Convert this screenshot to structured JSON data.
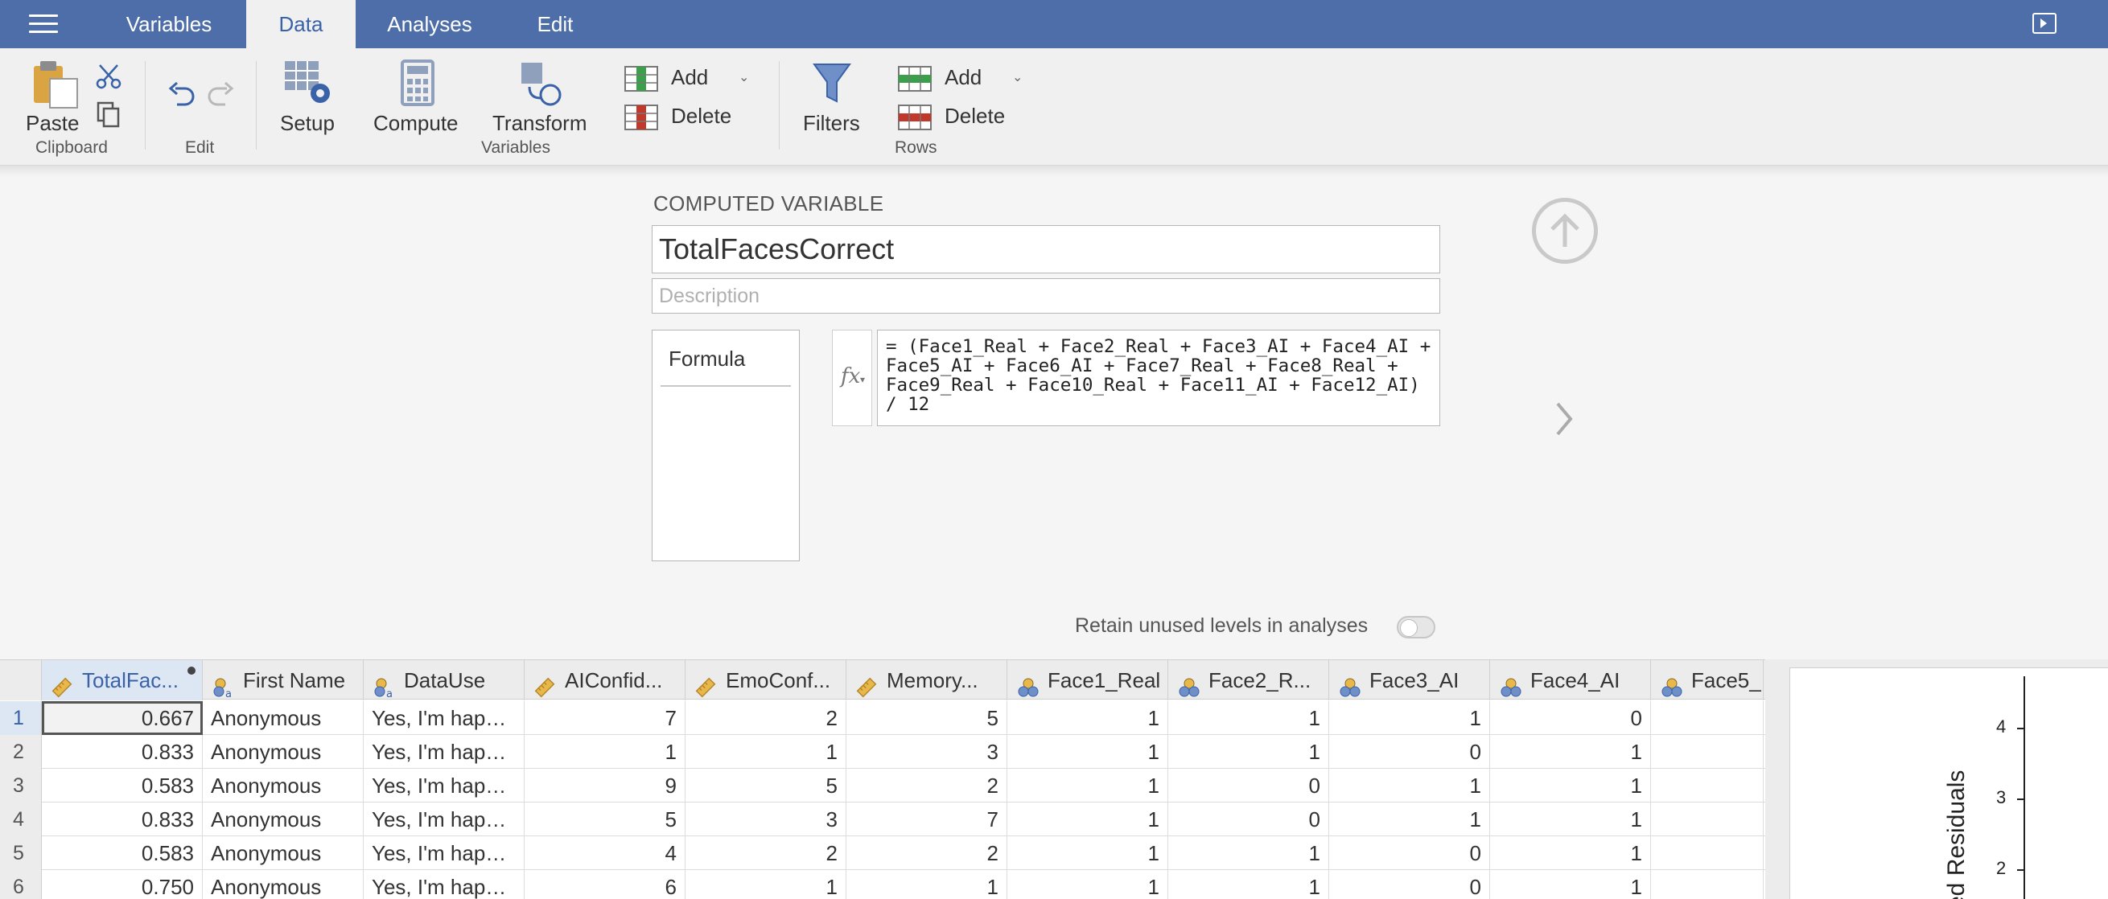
{
  "menubar": {
    "tabs": [
      {
        "label": "Variables"
      },
      {
        "label": "Data",
        "active": true
      },
      {
        "label": "Analyses"
      },
      {
        "label": "Edit"
      }
    ]
  },
  "ribbon": {
    "clipboard": {
      "paste_label": "Paste",
      "group_label": "Clipboard"
    },
    "edit": {
      "group_label": "Edit"
    },
    "variables": {
      "setup_label": "Setup",
      "compute_label": "Compute",
      "transform_label": "Transform",
      "add_label": "Add",
      "delete_label": "Delete",
      "group_label": "Variables"
    },
    "filters_label": "Filters",
    "rows": {
      "add_label": "Add",
      "delete_label": "Delete",
      "group_label": "Rows"
    },
    "icons": [
      "paste-icon",
      "cut-icon",
      "copy-icon",
      "undo-icon",
      "redo-icon",
      "setup-icon",
      "compute-icon",
      "transform-icon",
      "add-column-icon",
      "delete-column-icon",
      "filter-icon",
      "add-row-icon",
      "delete-row-icon"
    ]
  },
  "editor": {
    "heading": "COMPUTED VARIABLE",
    "name": "TotalFacesCorrect",
    "description_placeholder": "Description",
    "formula_tab": "Formula",
    "formula": "= (Face1_Real + Face2_Real + Face3_AI + Face4_AI + Face5_AI + Face6_AI + Face7_Real + Face8_Real + Face9_Real + Face10_Real + Face11_AI + Face12_AI) / 12",
    "retain_label": "Retain unused levels in analyses",
    "retain_on": false
  },
  "grid": {
    "columns": [
      {
        "label": "TotalFac...",
        "type": "continuous-icon"
      },
      {
        "label": "First Name",
        "type": "nominal-text-icon"
      },
      {
        "label": "DataUse",
        "type": "nominal-text-icon"
      },
      {
        "label": "AIConfid...",
        "type": "continuous-icon"
      },
      {
        "label": "EmoConf...",
        "type": "continuous-icon"
      },
      {
        "label": "Memory...",
        "type": "continuous-icon"
      },
      {
        "label": "Face1_Real",
        "type": "nominal-icon"
      },
      {
        "label": "Face2_R...",
        "type": "nominal-icon"
      },
      {
        "label": "Face3_AI",
        "type": "nominal-icon"
      },
      {
        "label": "Face4_AI",
        "type": "nominal-icon"
      },
      {
        "label": "Face5_",
        "type": "nominal-icon"
      }
    ],
    "rows": [
      {
        "num": "1",
        "cells": [
          "0.667",
          "Anonymous",
          "Yes, I'm hap…",
          "7",
          "2",
          "5",
          "1",
          "1",
          "1",
          "0",
          ""
        ]
      },
      {
        "num": "2",
        "cells": [
          "0.833",
          "Anonymous",
          "Yes, I'm hap…",
          "1",
          "1",
          "3",
          "1",
          "1",
          "0",
          "1",
          ""
        ]
      },
      {
        "num": "3",
        "cells": [
          "0.583",
          "Anonymous",
          "Yes, I'm hap…",
          "9",
          "5",
          "2",
          "1",
          "0",
          "1",
          "1",
          ""
        ]
      },
      {
        "num": "4",
        "cells": [
          "0.833",
          "Anonymous",
          "Yes, I'm hap…",
          "5",
          "3",
          "7",
          "1",
          "0",
          "1",
          "1",
          ""
        ]
      },
      {
        "num": "5",
        "cells": [
          "0.583",
          "Anonymous",
          "Yes, I'm hap…",
          "4",
          "2",
          "2",
          "1",
          "1",
          "0",
          "1",
          ""
        ]
      },
      {
        "num": "6",
        "cells": [
          "0.750",
          "Anonymous",
          "Yes, I'm hap…",
          "6",
          "1",
          "1",
          "1",
          "1",
          "0",
          "1",
          ""
        ]
      }
    ]
  },
  "results": {
    "y_ticks": [
      "4",
      "3",
      "2"
    ],
    "y_title": "ed Residuals"
  },
  "colors": {
    "menubar": "#4d6ea8",
    "accent": "#3a62a8"
  }
}
